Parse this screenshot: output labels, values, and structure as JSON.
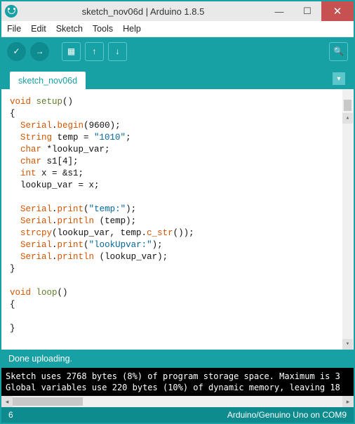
{
  "window": {
    "title": "sketch_nov06d | Arduino 1.8.5"
  },
  "menubar": {
    "file": "File",
    "edit": "Edit",
    "sketch": "Sketch",
    "tools": "Tools",
    "help": "Help"
  },
  "toolbar": {
    "verify": "✓",
    "upload": "→",
    "new": "▦",
    "open": "↑",
    "save": "↓",
    "serial": "🔍"
  },
  "tab": {
    "name": "sketch_nov06d",
    "dropdown": "▾"
  },
  "code": {
    "l01a": "void",
    "l01b": " ",
    "l01c": "setup",
    "l01d": "()",
    "l02": "{",
    "l03a": "  ",
    "l03b": "Serial",
    "l03c": ".",
    "l03d": "begin",
    "l03e": "(9600);",
    "l04a": "  ",
    "l04b": "String",
    "l04c": " temp = ",
    "l04d": "\"1010\"",
    "l04e": ";",
    "l05a": "  ",
    "l05b": "char",
    "l05c": " *lookup_var;",
    "l06a": "  ",
    "l06b": "char",
    "l06c": " s1[4];",
    "l07a": "  ",
    "l07b": "int",
    "l07c": " x = &s1;",
    "l08": "  lookup_var = x;",
    "l09": " ",
    "l10a": "  ",
    "l10b": "Serial",
    "l10c": ".",
    "l10d": "print",
    "l10e": "(",
    "l10f": "\"temp:\"",
    "l10g": ");",
    "l11a": "  ",
    "l11b": "Serial",
    "l11c": ".",
    "l11d": "println",
    "l11e": " (temp);",
    "l12a": "  ",
    "l12b": "strcpy",
    "l12c": "(lookup_var, temp.",
    "l12d": "c_str",
    "l12e": "());",
    "l13a": "  ",
    "l13b": "Serial",
    "l13c": ".",
    "l13d": "print",
    "l13e": "(",
    "l13f": "\"lookUpvar:\"",
    "l13g": ");",
    "l14a": "  ",
    "l14b": "Serial",
    "l14c": ".",
    "l14d": "println",
    "l14e": " (lookup_var);",
    "l15": "}",
    "l16": " ",
    "l17a": "void",
    "l17b": " ",
    "l17c": "loop",
    "l17d": "()",
    "l18": "{",
    "l19": " ",
    "l20": "}"
  },
  "status": {
    "message": "Done uploading."
  },
  "console": {
    "line1": "Sketch uses 2768 bytes (8%) of program storage space. Maximum is 3",
    "line2": "Global variables use 220 bytes (10%) of dynamic memory, leaving 18"
  },
  "footer": {
    "line": "6",
    "board": "Arduino/Genuino Uno on COM9"
  },
  "icons": {
    "minimize": "—",
    "maximize": "☐",
    "close": "✕",
    "scroll_up": "▴",
    "scroll_down": "▾",
    "scroll_left": "◂",
    "scroll_right": "▸"
  }
}
